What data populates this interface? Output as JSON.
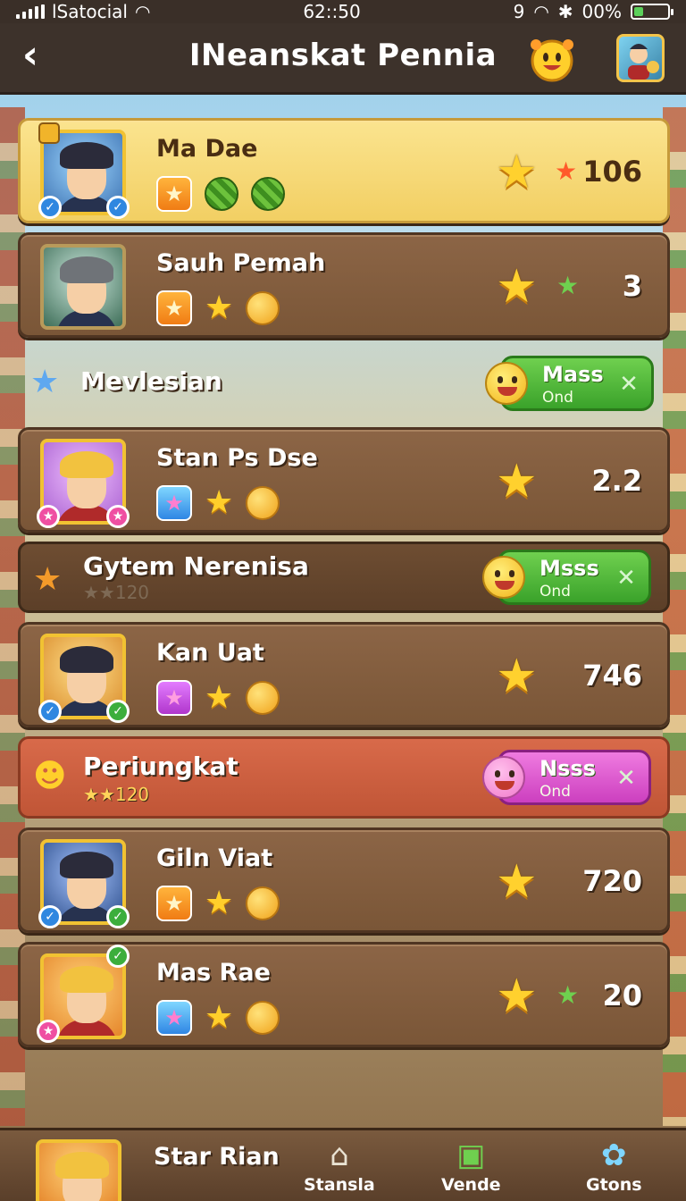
{
  "status_bar": {
    "carrier": "lSatocial",
    "time": "62::50",
    "signal_extra": "9",
    "battery": "00%"
  },
  "header": {
    "back_label": "‹",
    "title": "INeanskat Pennia"
  },
  "rows": [
    {
      "type": "player",
      "name": "Ma Dae",
      "score": "106",
      "highlight": true
    },
    {
      "type": "player",
      "name": "Sauh Pemah",
      "score": "3",
      "highlight": false
    },
    {
      "type": "group",
      "name": "Mevlesian",
      "sub": "",
      "button_title": "Mass",
      "button_sub": "Ond"
    },
    {
      "type": "player",
      "name": "Stan Ps Dse",
      "score": "2.2"
    },
    {
      "type": "group",
      "name": "Gytem Nerenisa",
      "sub": "★★120",
      "button_title": "Msss",
      "button_sub": "Ond"
    },
    {
      "type": "player",
      "name": "Kan Uat",
      "score": "746"
    },
    {
      "type": "group",
      "name": "Periungkat",
      "sub": "★★120",
      "button_title": "Nsss",
      "button_sub": "Ond"
    },
    {
      "type": "player",
      "name": "Giln Viat",
      "score": "720"
    },
    {
      "type": "player",
      "name": "Mas Rae",
      "score": "20"
    },
    {
      "type": "player",
      "name": "Star Rian",
      "score": ""
    }
  ],
  "bottom_nav": [
    {
      "label": "Stansla",
      "icon": "home-icon"
    },
    {
      "label": "Vende",
      "icon": "chat-icon"
    },
    {
      "label": "Gtons",
      "icon": "gear-icon"
    }
  ],
  "colors": {
    "header_bg": "#3d322b",
    "wood": "#7a5637",
    "highlight": "#f2cf63",
    "accent_green": "#3aa22a",
    "accent_pink": "#cc3fbf",
    "accent_red": "#c05536"
  }
}
